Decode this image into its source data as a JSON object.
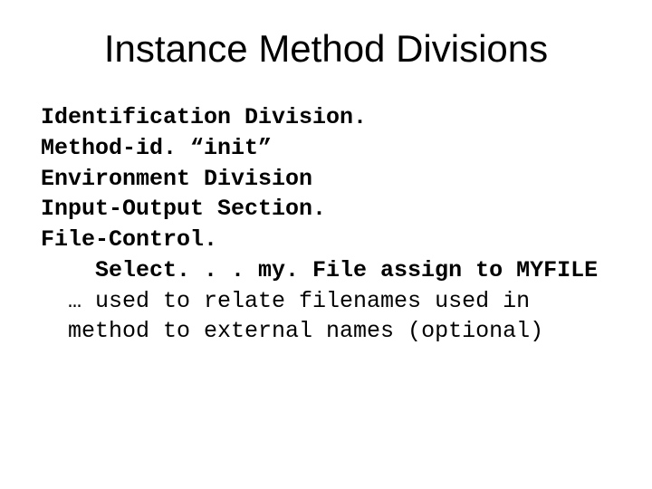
{
  "title": "Instance Method Divisions",
  "code": {
    "line1": "Identification Division.",
    "line2": "Method-id. “init”",
    "line3": "Environment Division",
    "line4": "Input-Output Section.",
    "line5": "File-Control.",
    "line6": "Select. . . my. File assign to MYFILE"
  },
  "note": {
    "line1": "… used to relate filenames used in",
    "line2": "method to external names (optional)"
  }
}
